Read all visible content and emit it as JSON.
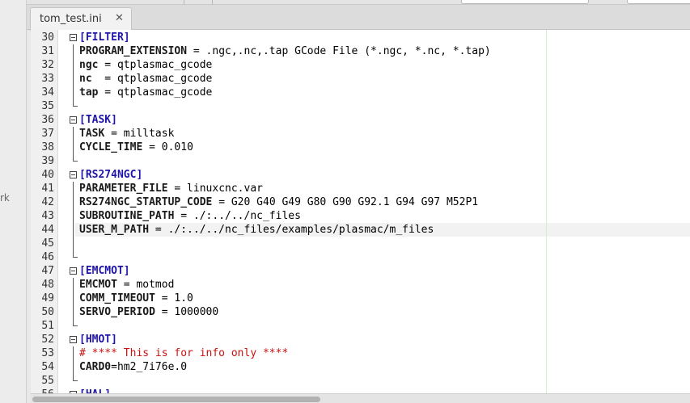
{
  "sidebar": {
    "partial_text": "rk"
  },
  "tab": {
    "label": "tom_test.ini",
    "close_glyph": "✕"
  },
  "editor": {
    "lines": [
      {
        "n": "30",
        "fold": "open",
        "parts": [
          {
            "c": "sec",
            "t": "[FILTER]"
          }
        ]
      },
      {
        "n": "31",
        "fold": "stem",
        "parts": [
          {
            "c": "key",
            "t": "PROGRAM_EXTENSION"
          },
          {
            "c": "",
            "t": " = .ngc,.nc,.tap GCode File (*.ngc, *.nc, *.tap)"
          }
        ]
      },
      {
        "n": "32",
        "fold": "stem",
        "parts": [
          {
            "c": "key",
            "t": "ngc"
          },
          {
            "c": "",
            "t": " = qtplasmac_gcode"
          }
        ]
      },
      {
        "n": "33",
        "fold": "stem",
        "parts": [
          {
            "c": "key",
            "t": "nc"
          },
          {
            "c": "",
            "t": "  = qtplasmac_gcode"
          }
        ]
      },
      {
        "n": "34",
        "fold": "stem",
        "parts": [
          {
            "c": "key",
            "t": "tap"
          },
          {
            "c": "",
            "t": " = qtplasmac_gcode"
          }
        ]
      },
      {
        "n": "35",
        "fold": "end",
        "parts": []
      },
      {
        "n": "36",
        "fold": "open",
        "parts": [
          {
            "c": "sec",
            "t": "[TASK]"
          }
        ]
      },
      {
        "n": "37",
        "fold": "stem",
        "parts": [
          {
            "c": "key",
            "t": "TASK"
          },
          {
            "c": "",
            "t": " = milltask"
          }
        ]
      },
      {
        "n": "38",
        "fold": "stem",
        "parts": [
          {
            "c": "key",
            "t": "CYCLE_TIME"
          },
          {
            "c": "",
            "t": " = 0.010"
          }
        ]
      },
      {
        "n": "39",
        "fold": "end",
        "parts": []
      },
      {
        "n": "40",
        "fold": "open",
        "parts": [
          {
            "c": "sec",
            "t": "[RS274NGC]"
          }
        ]
      },
      {
        "n": "41",
        "fold": "stem",
        "parts": [
          {
            "c": "key",
            "t": "PARAMETER_FILE"
          },
          {
            "c": "",
            "t": " = linuxcnc.var"
          }
        ]
      },
      {
        "n": "42",
        "fold": "stem",
        "parts": [
          {
            "c": "key",
            "t": "RS274NGC_STARTUP_CODE"
          },
          {
            "c": "",
            "t": " = G20 G40 G49 G80 G90 G92.1 G94 G97 M52P1"
          }
        ]
      },
      {
        "n": "43",
        "fold": "stem",
        "parts": [
          {
            "c": "key",
            "t": "SUBROUTINE_PATH"
          },
          {
            "c": "",
            "t": " = ./:../../nc_files"
          }
        ]
      },
      {
        "n": "44",
        "fold": "stem",
        "parts": [
          {
            "c": "key",
            "t": "USER_M_PATH"
          },
          {
            "c": "",
            "t": " = ./:../../nc_files/examples/plasmac/m_files"
          }
        ]
      },
      {
        "n": "45",
        "fold": "stem",
        "parts": []
      },
      {
        "n": "46",
        "fold": "end",
        "parts": []
      },
      {
        "n": "47",
        "fold": "open",
        "parts": [
          {
            "c": "sec",
            "t": "[EMCMOT]"
          }
        ]
      },
      {
        "n": "48",
        "fold": "stem",
        "parts": [
          {
            "c": "key",
            "t": "EMCMOT"
          },
          {
            "c": "",
            "t": " = motmod"
          }
        ]
      },
      {
        "n": "49",
        "fold": "stem",
        "parts": [
          {
            "c": "key",
            "t": "COMM_TIMEOUT"
          },
          {
            "c": "",
            "t": " = 1.0"
          }
        ]
      },
      {
        "n": "50",
        "fold": "stem",
        "parts": [
          {
            "c": "key",
            "t": "SERVO_PERIOD"
          },
          {
            "c": "",
            "t": " = 1000000"
          }
        ]
      },
      {
        "n": "51",
        "fold": "end",
        "parts": []
      },
      {
        "n": "52",
        "fold": "open",
        "parts": [
          {
            "c": "sec",
            "t": "[HMOT]"
          }
        ]
      },
      {
        "n": "53",
        "fold": "stem",
        "parts": [
          {
            "c": "cmt",
            "t": "# **** This is for info only ****"
          }
        ]
      },
      {
        "n": "54",
        "fold": "stem",
        "parts": [
          {
            "c": "key",
            "t": "CARD0"
          },
          {
            "c": "",
            "t": "=hm2_7i76e.0"
          }
        ]
      },
      {
        "n": "55",
        "fold": "end",
        "parts": []
      },
      {
        "n": "56",
        "fold": "open",
        "parts": [
          {
            "c": "sec",
            "t": "[HAL]"
          }
        ]
      }
    ]
  }
}
